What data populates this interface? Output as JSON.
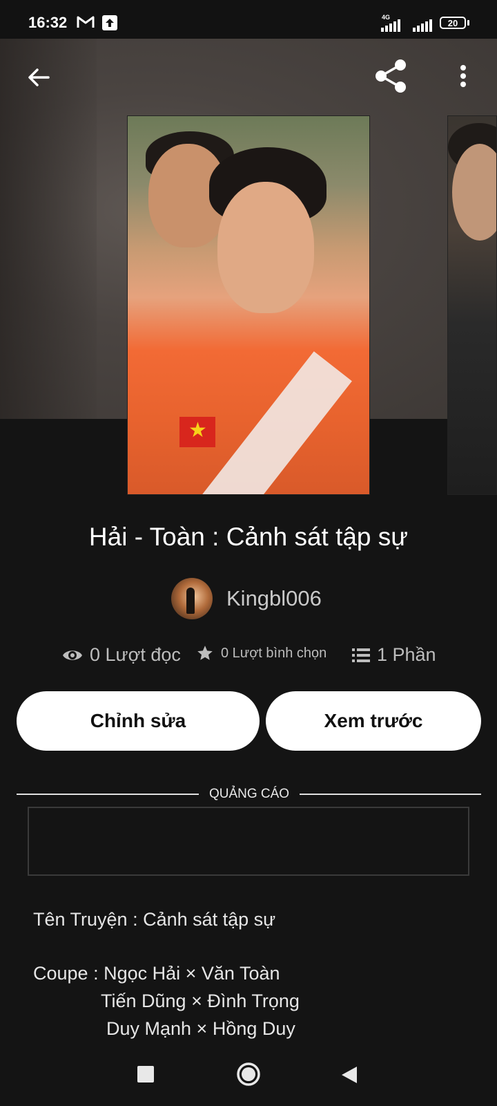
{
  "status_bar": {
    "time": "16:32",
    "network_label": "4G",
    "battery": "20",
    "icons": [
      "gmail-icon",
      "upload-icon",
      "signal-icon",
      "signal-icon",
      "battery-icon"
    ]
  },
  "top_bar": {
    "icons": [
      "back-arrow-icon",
      "share-icon",
      "more-vert-icon"
    ]
  },
  "story": {
    "title": "Hải - Toàn : Cảnh sát tập sự",
    "author": "Kingbl006"
  },
  "stats": {
    "reads": "0 Lượt đọc",
    "votes": "0 Lượt bình chọn",
    "parts": "1 Phần",
    "icons": [
      "eye-icon",
      "star-icon",
      "list-icon"
    ]
  },
  "buttons": {
    "edit": "Chỉnh sửa",
    "preview": "Xem trước"
  },
  "ad": {
    "label": "QUẢNG CÁO"
  },
  "description": {
    "line1": "Tên Truyện : Cảnh sát tập sự",
    "line2": "Coupe : Ngọc Hải × Văn Toàn",
    "line3": "Tiến Dũng × Đình Trọng",
    "line4": "Duy Mạnh × Hồng Duy"
  },
  "nav": {
    "icons": [
      "recents-icon",
      "home-icon",
      "back-icon"
    ]
  },
  "colors": {
    "background": "#141414",
    "button_bg": "#ffffff",
    "muted_text": "#bdbdbd"
  }
}
